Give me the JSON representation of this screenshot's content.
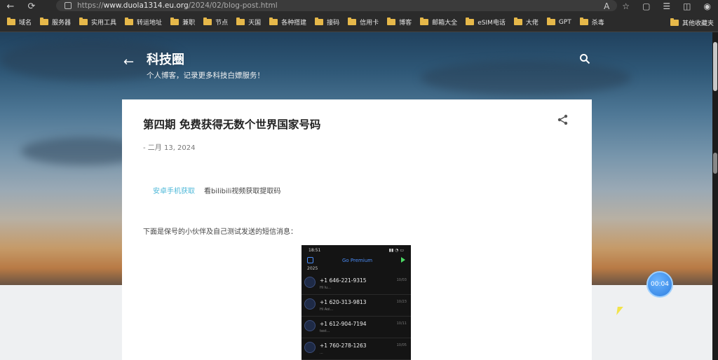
{
  "browser": {
    "url_scheme": "https://",
    "url_domain": "www.duola1314.eu.org",
    "url_path": "/2024/02/blog-post.html",
    "back_glyph": "←",
    "refresh_glyph": "⟳"
  },
  "bookmarks": [
    "域名",
    "服务器",
    "实用工具",
    "转运地址",
    "兼职",
    "节点",
    "天国",
    "各种搭建",
    "接码",
    "信用卡",
    "博客",
    "邮箱大全",
    "eSIM电话",
    "大佬",
    "GPT",
    "杀毒"
  ],
  "bookmarks_other": "其他收藏夹",
  "blog": {
    "back_glyph": "←",
    "title": "科技圈",
    "description": "个人博客，记录更多科技白嫖服务！"
  },
  "post": {
    "title": "第四期 免费获得无数个世界国家号码",
    "date": "- 二月 13, 2024",
    "link_text": "安卓手机获取",
    "link_rest": "看bilibili视频获取提取码",
    "paragraph": "下面是保号的小伙伴及自己测试发送的短信消息："
  },
  "phone": {
    "time": "18:51",
    "header": "Go Premium",
    "year": "2025",
    "rows": [
      {
        "number": "+1 646-221-9315",
        "sub": "Hi lu...",
        "time": "10/03"
      },
      {
        "number": "+1 620-313-9813",
        "sub": "Hi Aoi...",
        "time": "10/23"
      },
      {
        "number": "+1 612-904-7194",
        "sub": "test...",
        "time": "10/11"
      },
      {
        "number": "+1 760-278-1263",
        "sub": "...",
        "time": "10/05"
      }
    ]
  },
  "overlay_timer": "00:04",
  "colors": {
    "accent_link": "#4eb8d8",
    "folder": "#e6b84a"
  }
}
